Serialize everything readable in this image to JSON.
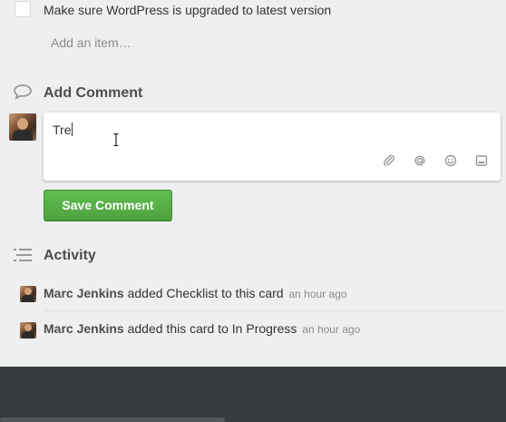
{
  "checklist": {
    "item_label": "Make sure WordPress is upgraded to latest version",
    "add_item_placeholder": "Add an item…"
  },
  "comment": {
    "header": "Add Comment",
    "value": "Tre",
    "save_label": "Save Comment",
    "tools": [
      "attachment-icon",
      "mention-icon",
      "emoji-icon",
      "card-icon"
    ]
  },
  "activity": {
    "header": "Activity",
    "items": [
      {
        "user": "Marc Jenkins",
        "action": "added Checklist to this card",
        "time": "an hour ago"
      },
      {
        "user": "Marc Jenkins",
        "action": "added this card to In Progress",
        "time": "an hour ago"
      }
    ]
  },
  "colors": {
    "background": "#edeff0",
    "save_button": "#5aac44",
    "footer": "#363b3e"
  }
}
